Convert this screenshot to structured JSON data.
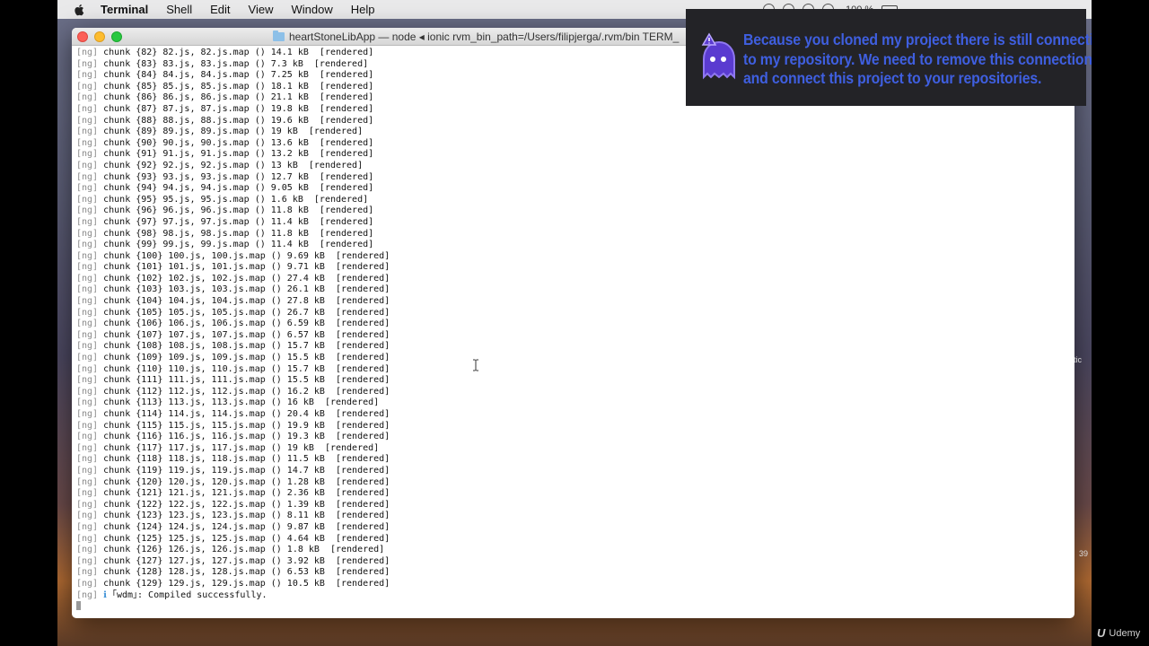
{
  "menubar": {
    "app_name": "Terminal",
    "items": [
      "Shell",
      "Edit",
      "View",
      "Window",
      "Help"
    ],
    "battery": "100 %"
  },
  "window": {
    "title": "heartStoneLibApp — node ◂ ionic rvm_bin_path=/Users/filipjerga/.rvm/bin TERM_"
  },
  "terminal": {
    "lines": [
      {
        "prefix": "[ng]",
        "text": " chunk {82} 82.js, 82.js.map () 14.1 kB  [rendered]"
      },
      {
        "prefix": "[ng]",
        "text": " chunk {83} 83.js, 83.js.map () 7.3 kB  [rendered]"
      },
      {
        "prefix": "[ng]",
        "text": " chunk {84} 84.js, 84.js.map () 7.25 kB  [rendered]"
      },
      {
        "prefix": "[ng]",
        "text": " chunk {85} 85.js, 85.js.map () 18.1 kB  [rendered]"
      },
      {
        "prefix": "[ng]",
        "text": " chunk {86} 86.js, 86.js.map () 21.1 kB  [rendered]"
      },
      {
        "prefix": "[ng]",
        "text": " chunk {87} 87.js, 87.js.map () 19.8 kB  [rendered]"
      },
      {
        "prefix": "[ng]",
        "text": " chunk {88} 88.js, 88.js.map () 19.6 kB  [rendered]"
      },
      {
        "prefix": "[ng]",
        "text": " chunk {89} 89.js, 89.js.map () 19 kB  [rendered]"
      },
      {
        "prefix": "[ng]",
        "text": " chunk {90} 90.js, 90.js.map () 13.6 kB  [rendered]"
      },
      {
        "prefix": "[ng]",
        "text": " chunk {91} 91.js, 91.js.map () 13.2 kB  [rendered]"
      },
      {
        "prefix": "[ng]",
        "text": " chunk {92} 92.js, 92.js.map () 13 kB  [rendered]"
      },
      {
        "prefix": "[ng]",
        "text": " chunk {93} 93.js, 93.js.map () 12.7 kB  [rendered]"
      },
      {
        "prefix": "[ng]",
        "text": " chunk {94} 94.js, 94.js.map () 9.05 kB  [rendered]"
      },
      {
        "prefix": "[ng]",
        "text": " chunk {95} 95.js, 95.js.map () 1.6 kB  [rendered]"
      },
      {
        "prefix": "[ng]",
        "text": " chunk {96} 96.js, 96.js.map () 11.8 kB  [rendered]"
      },
      {
        "prefix": "[ng]",
        "text": " chunk {97} 97.js, 97.js.map () 11.4 kB  [rendered]"
      },
      {
        "prefix": "[ng]",
        "text": " chunk {98} 98.js, 98.js.map () 11.8 kB  [rendered]"
      },
      {
        "prefix": "[ng]",
        "text": " chunk {99} 99.js, 99.js.map () 11.4 kB  [rendered]"
      },
      {
        "prefix": "[ng]",
        "text": " chunk {100} 100.js, 100.js.map () 9.69 kB  [rendered]"
      },
      {
        "prefix": "[ng]",
        "text": " chunk {101} 101.js, 101.js.map () 9.71 kB  [rendered]"
      },
      {
        "prefix": "[ng]",
        "text": " chunk {102} 102.js, 102.js.map () 27.4 kB  [rendered]"
      },
      {
        "prefix": "[ng]",
        "text": " chunk {103} 103.js, 103.js.map () 26.1 kB  [rendered]"
      },
      {
        "prefix": "[ng]",
        "text": " chunk {104} 104.js, 104.js.map () 27.8 kB  [rendered]"
      },
      {
        "prefix": "[ng]",
        "text": " chunk {105} 105.js, 105.js.map () 26.7 kB  [rendered]"
      },
      {
        "prefix": "[ng]",
        "text": " chunk {106} 106.js, 106.js.map () 6.59 kB  [rendered]"
      },
      {
        "prefix": "[ng]",
        "text": " chunk {107} 107.js, 107.js.map () 6.57 kB  [rendered]"
      },
      {
        "prefix": "[ng]",
        "text": " chunk {108} 108.js, 108.js.map () 15.7 kB  [rendered]"
      },
      {
        "prefix": "[ng]",
        "text": " chunk {109} 109.js, 109.js.map () 15.5 kB  [rendered]"
      },
      {
        "prefix": "[ng]",
        "text": " chunk {110} 110.js, 110.js.map () 15.7 kB  [rendered]"
      },
      {
        "prefix": "[ng]",
        "text": " chunk {111} 111.js, 111.js.map () 15.5 kB  [rendered]"
      },
      {
        "prefix": "[ng]",
        "text": " chunk {112} 112.js, 112.js.map () 16.2 kB  [rendered]"
      },
      {
        "prefix": "[ng]",
        "text": " chunk {113} 113.js, 113.js.map () 16 kB  [rendered]"
      },
      {
        "prefix": "[ng]",
        "text": " chunk {114} 114.js, 114.js.map () 20.4 kB  [rendered]"
      },
      {
        "prefix": "[ng]",
        "text": " chunk {115} 115.js, 115.js.map () 19.9 kB  [rendered]"
      },
      {
        "prefix": "[ng]",
        "text": " chunk {116} 116.js, 116.js.map () 19.3 kB  [rendered]"
      },
      {
        "prefix": "[ng]",
        "text": " chunk {117} 117.js, 117.js.map () 19 kB  [rendered]"
      },
      {
        "prefix": "[ng]",
        "text": " chunk {118} 118.js, 118.js.map () 11.5 kB  [rendered]"
      },
      {
        "prefix": "[ng]",
        "text": " chunk {119} 119.js, 119.js.map () 14.7 kB  [rendered]"
      },
      {
        "prefix": "[ng]",
        "text": " chunk {120} 120.js, 120.js.map () 1.28 kB  [rendered]"
      },
      {
        "prefix": "[ng]",
        "text": " chunk {121} 121.js, 121.js.map () 2.36 kB  [rendered]"
      },
      {
        "prefix": "[ng]",
        "text": " chunk {122} 122.js, 122.js.map () 1.39 kB  [rendered]"
      },
      {
        "prefix": "[ng]",
        "text": " chunk {123} 123.js, 123.js.map () 8.11 kB  [rendered]"
      },
      {
        "prefix": "[ng]",
        "text": " chunk {124} 124.js, 124.js.map () 9.87 kB  [rendered]"
      },
      {
        "prefix": "[ng]",
        "text": " chunk {125} 125.js, 125.js.map () 4.64 kB  [rendered]"
      },
      {
        "prefix": "[ng]",
        "text": " chunk {126} 126.js, 126.js.map () 1.8 kB  [rendered]"
      },
      {
        "prefix": "[ng]",
        "text": " chunk {127} 127.js, 127.js.map () 3.92 kB  [rendered]"
      },
      {
        "prefix": "[ng]",
        "text": " chunk {128} 128.js, 128.js.map () 6.53 kB  [rendered]"
      },
      {
        "prefix": "[ng]",
        "text": " chunk {129} 129.js, 129.js.map () 10.5 kB  [rendered]"
      }
    ],
    "final_line": {
      "prefix": "[ng]",
      "info_icon": "ℹ",
      "text": " ｢wdm｣: Compiled successfully."
    }
  },
  "notice": {
    "lines": [
      "Because you cloned my project there is still connection",
      "to my repository. We need to remove this connection",
      "and connect this project to your repositories."
    ],
    "text_color": "#3f5fe0",
    "icon": "ghost-warning-icon"
  },
  "desktop_edge": {
    "right_text_1": "tic",
    "right_text_2": "39"
  },
  "watermark": {
    "logo": "udemy-logo-icon",
    "text": "Udemy"
  }
}
